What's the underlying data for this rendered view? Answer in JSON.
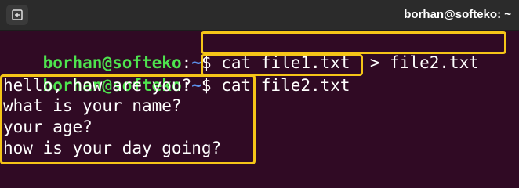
{
  "titlebar": {
    "title": "borhan@softeko: ~",
    "new_tab_icon": "new-tab-icon"
  },
  "terminal": {
    "prompt_user": "borhan@softeko",
    "prompt_sep": ":",
    "prompt_path": "~",
    "prompt_symbol": "$",
    "commands": [
      "cat file1.txt  > file2.txt",
      "cat file2.txt"
    ],
    "output": [
      "hello, how are you?",
      "what is your name?",
      "your age?",
      "how is your day going?"
    ]
  },
  "colors": {
    "background": "#300a24",
    "user": "#4ee44e",
    "path": "#5c8fe8",
    "highlight": "#f5c518"
  }
}
